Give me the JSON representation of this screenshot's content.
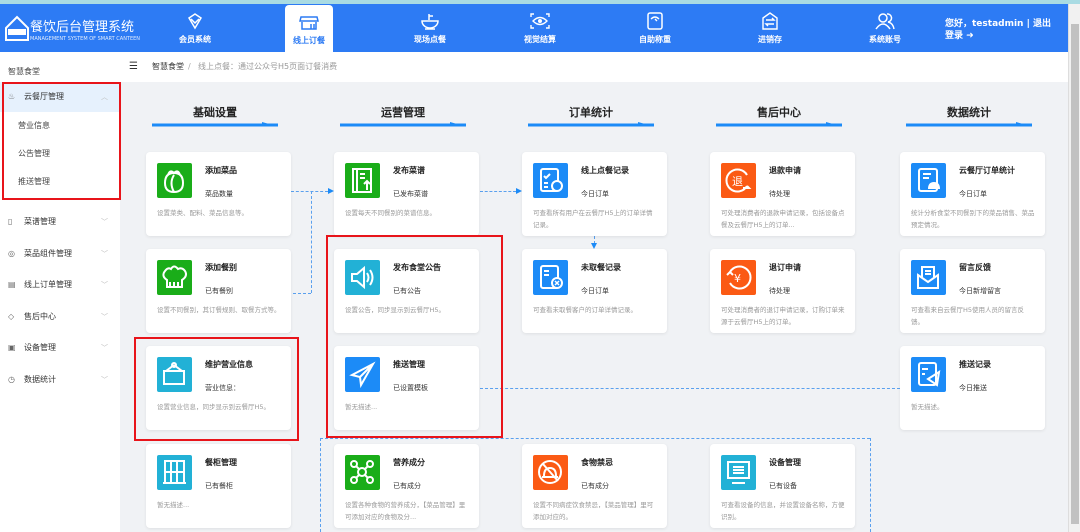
{
  "header": {
    "brand": "餐饮后台管理系统",
    "brand_sub": "MANAGEMENT SYSTEM OF SMART CANTEEN",
    "logo_text": "智慧食堂",
    "nav": [
      {
        "label": "会员系统",
        "icon": "diamond-icon"
      },
      {
        "label": "线上订餐",
        "icon": "shop-icon",
        "active": true
      },
      {
        "label": "现场点餐",
        "icon": "bowl-icon"
      },
      {
        "label": "视觉结算",
        "icon": "eye-scan-icon"
      },
      {
        "label": "自助称重",
        "icon": "scale-icon"
      },
      {
        "label": "进销存",
        "icon": "exchange-icon"
      },
      {
        "label": "系统账号",
        "icon": "users-icon"
      }
    ],
    "greeting": "您好，testadmin",
    "logout": "退出登录"
  },
  "sidebar": {
    "title": "智慧食堂",
    "items": [
      {
        "label": "云餐厅管理",
        "expanded": true,
        "children": [
          "营业信息",
          "公告管理",
          "推送管理"
        ]
      },
      {
        "label": "菜谱管理"
      },
      {
        "label": "菜品组件管理"
      },
      {
        "label": "线上订单管理"
      },
      {
        "label": "售后中心"
      },
      {
        "label": "设备管理"
      },
      {
        "label": "数据统计"
      }
    ]
  },
  "breadcrumb": {
    "root": "智慧食堂",
    "sep": "/",
    "current": "线上点餐：通过公众号H5页面订餐消费"
  },
  "sections": [
    "基础设置",
    "运营管理",
    "订单统计",
    "售后中心",
    "数据统计"
  ],
  "colors": {
    "green": "#1aad19",
    "cyan": "#22b1d6",
    "blue": "#1c8bf7",
    "orange": "#fb5a14",
    "accent": "#2d7bf4",
    "highlight": "#e8141a"
  },
  "cards": [
    {
      "title": "添加菜品",
      "sub": "菜品数量",
      "desc": "设置菜类、配料、菜品信息等。",
      "icon": "vegetable-icon",
      "color": "green"
    },
    {
      "title": "添加餐别",
      "sub": "已有餐别",
      "desc": "设置不同餐别，其订餐规则、取餐方式等。",
      "icon": "chef-hat-icon",
      "color": "green"
    },
    {
      "title": "维护营业信息",
      "sub": "营业信息：",
      "desc": "设置营业信息，同步显示到云餐厅H5。",
      "icon": "hanging-sign-icon",
      "color": "cyan"
    },
    {
      "title": "餐柜管理",
      "sub": "已有餐柜",
      "desc": "暂无描述...",
      "icon": "cabinet-icon",
      "color": "cyan"
    },
    {
      "title": "发布菜谱",
      "sub": "已发布菜谱",
      "desc": "设置每天不同餐别的菜谱信息。",
      "icon": "menu-upload-icon",
      "color": "green"
    },
    {
      "title": "发布食堂公告",
      "sub": "已有公告",
      "desc": "设置公告，同步显示到云餐厅H5。",
      "icon": "speaker-icon",
      "color": "cyan"
    },
    {
      "title": "推送管理",
      "sub": "已设置模板",
      "desc": "暂无描述...",
      "icon": "paper-plane-icon",
      "color": "blue"
    },
    {
      "title": "营养成分",
      "sub": "已有成分",
      "desc": "设置各种食物的营养成分，【菜品管理】里可添加对应的食物及分...",
      "icon": "molecule-icon",
      "color": "green"
    },
    {
      "title": "线上点餐记录",
      "sub": "今日订单",
      "desc": "可查看所有用户在云餐厅H5上的订单详情记录。",
      "icon": "order-record-icon",
      "color": "blue"
    },
    {
      "title": "未取餐记录",
      "sub": "今日订单",
      "desc": "可查看未取餐客户的订单详情记录。",
      "icon": "order-cancel-icon",
      "color": "blue"
    },
    {
      "title": "食物禁忌",
      "sub": "已有成分",
      "desc": "设置不同病症饮食禁忌，【菜品管理】里可添加对应的。",
      "icon": "no-food-icon",
      "color": "orange"
    },
    {
      "title": "退款申请",
      "sub": "待处理",
      "desc": "可处理消费者的退款申请记录，包括设备点餐及云餐厅H5上的订单...",
      "icon": "refund-icon",
      "color": "orange"
    },
    {
      "title": "退订申请",
      "sub": "待处理",
      "desc": "可处理消费者的退订申请记录，订购订单来源于云餐厅H5上的订单。",
      "icon": "yen-return-icon",
      "color": "orange"
    },
    {
      "title": "设备管理",
      "sub": "已有设备",
      "desc": "可查看设备的信息，并设置设备名称，方便识别。",
      "icon": "device-icon",
      "color": "cyan"
    },
    {
      "title": "云餐厅订单统计",
      "sub": "今日订单",
      "desc": "统计分析食堂不同餐别下的菜品销售、菜品预定情况。",
      "icon": "order-stats-icon",
      "color": "blue"
    },
    {
      "title": "留言反馈",
      "sub": "今日新增留言",
      "desc": "可查看来自云餐厅H5使用人员的留言反馈。",
      "icon": "mail-icon",
      "color": "blue"
    },
    {
      "title": "推送记录",
      "sub": "今日推送",
      "desc": "暂无描述。",
      "icon": "push-record-icon",
      "color": "blue"
    }
  ]
}
